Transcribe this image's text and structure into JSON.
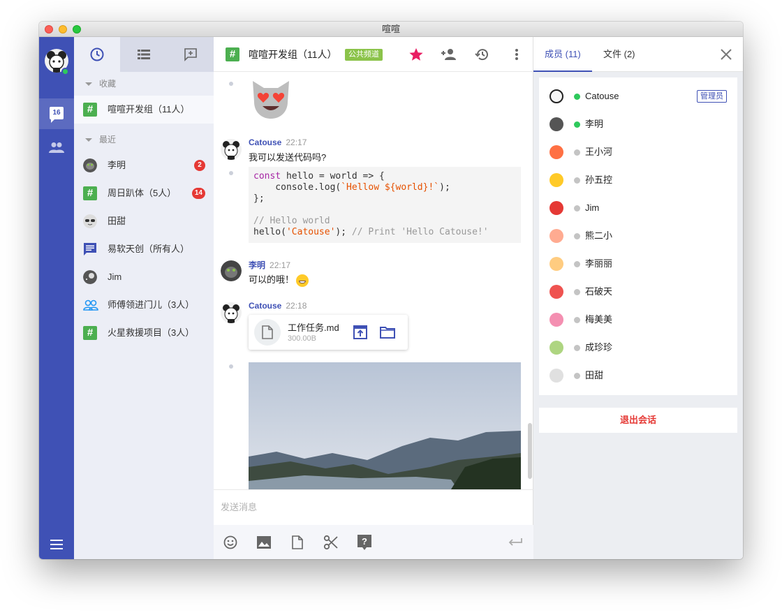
{
  "window": {
    "title": "喧喧"
  },
  "rail": {
    "chat_count": "16",
    "icons": [
      "avatar",
      "chat-icon",
      "contacts-icon",
      "menu-icon"
    ]
  },
  "sessions": {
    "tabs": [
      "clock-icon",
      "list-icon",
      "new-chat-icon"
    ],
    "favorites_label": "收藏",
    "recent_label": "最近",
    "favorites": [
      {
        "name": "喧喧开发组（11人）",
        "icon": "hash-icon"
      }
    ],
    "recent": [
      {
        "name": "李明",
        "badge": "2",
        "icon": "gorilla-avatar"
      },
      {
        "name": "周日趴体（5人）",
        "badge": "14",
        "icon": "hash-icon"
      },
      {
        "name": "田甜",
        "badge": "",
        "icon": "cat-sunglasses-avatar"
      },
      {
        "name": "易软天创（所有人）",
        "badge": "",
        "icon": "message-icon"
      },
      {
        "name": "Jim",
        "badge": "",
        "icon": "space-avatar"
      },
      {
        "name": "师傅领进门儿（3人）",
        "badge": "",
        "icon": "people-icon"
      },
      {
        "name": "火星救援项目（3人）",
        "badge": "",
        "icon": "hash-icon"
      }
    ]
  },
  "chat": {
    "title": "喧喧开发组（11人）",
    "tag": "公共频道",
    "accent": "#3f51b5",
    "messages": [
      {
        "author": "Catouse",
        "time": "22:17",
        "text": "我可以发送代码吗?"
      },
      {
        "author": "李明",
        "time": "22:17",
        "text": "可以的哦！"
      },
      {
        "author": "Catouse",
        "time": "22:18"
      }
    ],
    "code": {
      "l1a": "const",
      "l1b": " hello = world => {",
      "l2a": "    console.log(",
      "l2b": "`Hellow ${world}!`",
      "l2c": ");",
      "l3": "};",
      "l5": "// Hello world",
      "l6a": "hello(",
      "l6b": "'Catouse'",
      "l6c": "); ",
      "l6d": "// Print 'Hello Catouse!'"
    },
    "file": {
      "name": "工作任务.md",
      "size": "300.00B"
    },
    "composer_placeholder": "发送消息",
    "tools": [
      "emoji-icon",
      "image-icon",
      "file-icon",
      "scissors-icon",
      "help-icon",
      "enter-icon"
    ]
  },
  "panel": {
    "tab_members": "成员 (11)",
    "tab_files": "文件 (2)",
    "admin_label": "管理员",
    "leave_label": "退出会话",
    "members": [
      {
        "name": "Catouse",
        "online": true,
        "admin": true
      },
      {
        "name": "李明",
        "online": true,
        "admin": false
      },
      {
        "name": "王小河",
        "online": false,
        "admin": false
      },
      {
        "name": "孙五控",
        "online": false,
        "admin": false
      },
      {
        "name": "Jim",
        "online": false,
        "admin": false
      },
      {
        "name": "熊二小",
        "online": false,
        "admin": false
      },
      {
        "name": "李丽丽",
        "online": false,
        "admin": false
      },
      {
        "name": "石破天",
        "online": false,
        "admin": false
      },
      {
        "name": "梅美美",
        "online": false,
        "admin": false
      },
      {
        "name": "成珍珍",
        "online": false,
        "admin": false
      },
      {
        "name": "田甜",
        "online": false,
        "admin": false
      }
    ],
    "colors": {
      "online": "#2ec95c",
      "offline": "#c4c4c4"
    }
  }
}
